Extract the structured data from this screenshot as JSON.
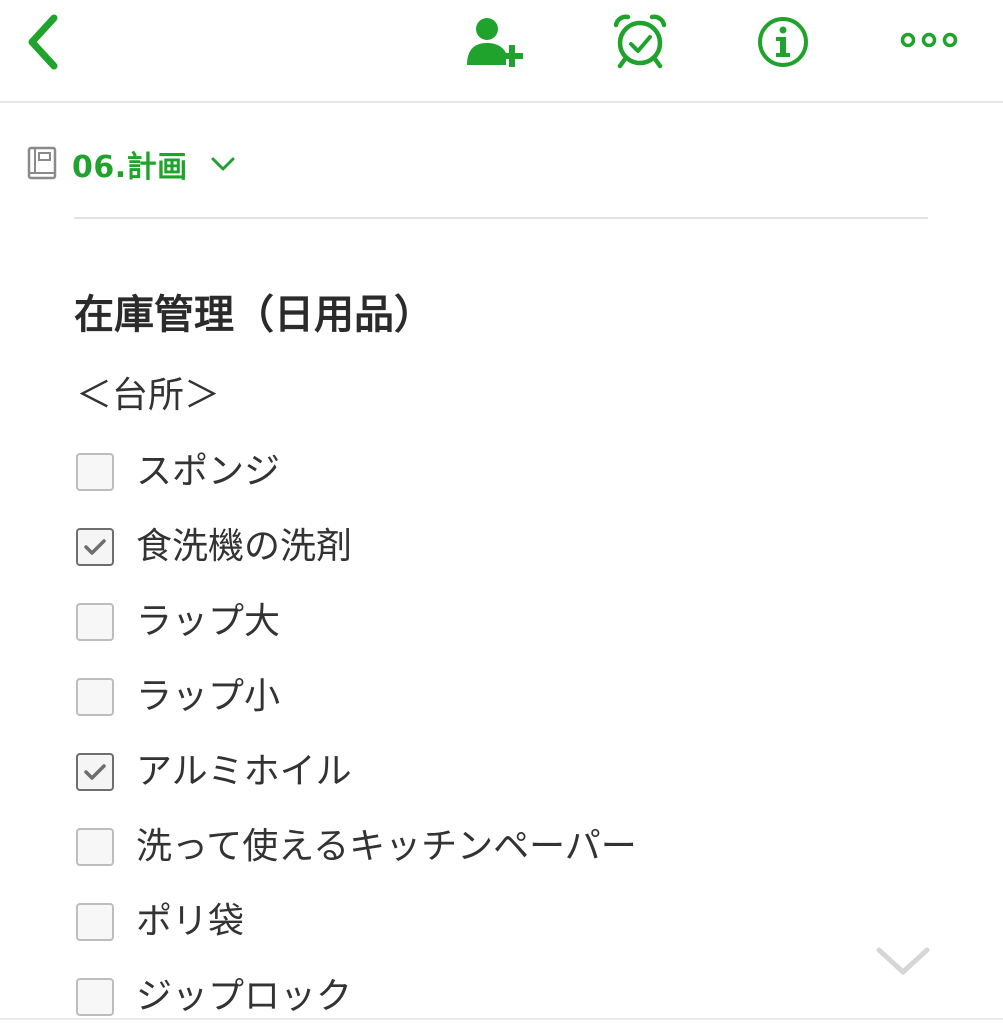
{
  "colors": {
    "accent": "#1fa32c",
    "text": "#333333",
    "title": "#2b2b2b",
    "divider": "#e3e3e3",
    "checkbox_border": "#bdbdbd",
    "check_mark": "#6e6e6e",
    "chevron_muted": "#d6d6d6"
  },
  "toolbar": {
    "back_icon": "chevron-left-icon",
    "share_icon": "add-person-icon",
    "reminder_icon": "alarm-clock-icon",
    "info_icon": "info-icon",
    "more_icon": "more-dots-icon"
  },
  "notebook": {
    "icon": "notebook-icon",
    "name": "06.計画",
    "dropdown_icon": "chevron-down-icon"
  },
  "note": {
    "title": "在庫管理（日用品）",
    "section": "＜台所＞",
    "checklist": [
      {
        "label": "スポンジ",
        "checked": false
      },
      {
        "label": "食洗機の洗剤",
        "checked": true
      },
      {
        "label": "ラップ大",
        "checked": false
      },
      {
        "label": "ラップ小",
        "checked": false
      },
      {
        "label": "アルミホイル",
        "checked": true
      },
      {
        "label": "洗って使えるキッチンペーパー",
        "checked": false
      },
      {
        "label": "ポリ袋",
        "checked": false
      },
      {
        "label": "ジップロック",
        "checked": false
      }
    ]
  },
  "scroll_indicator_icon": "chevron-down-icon"
}
